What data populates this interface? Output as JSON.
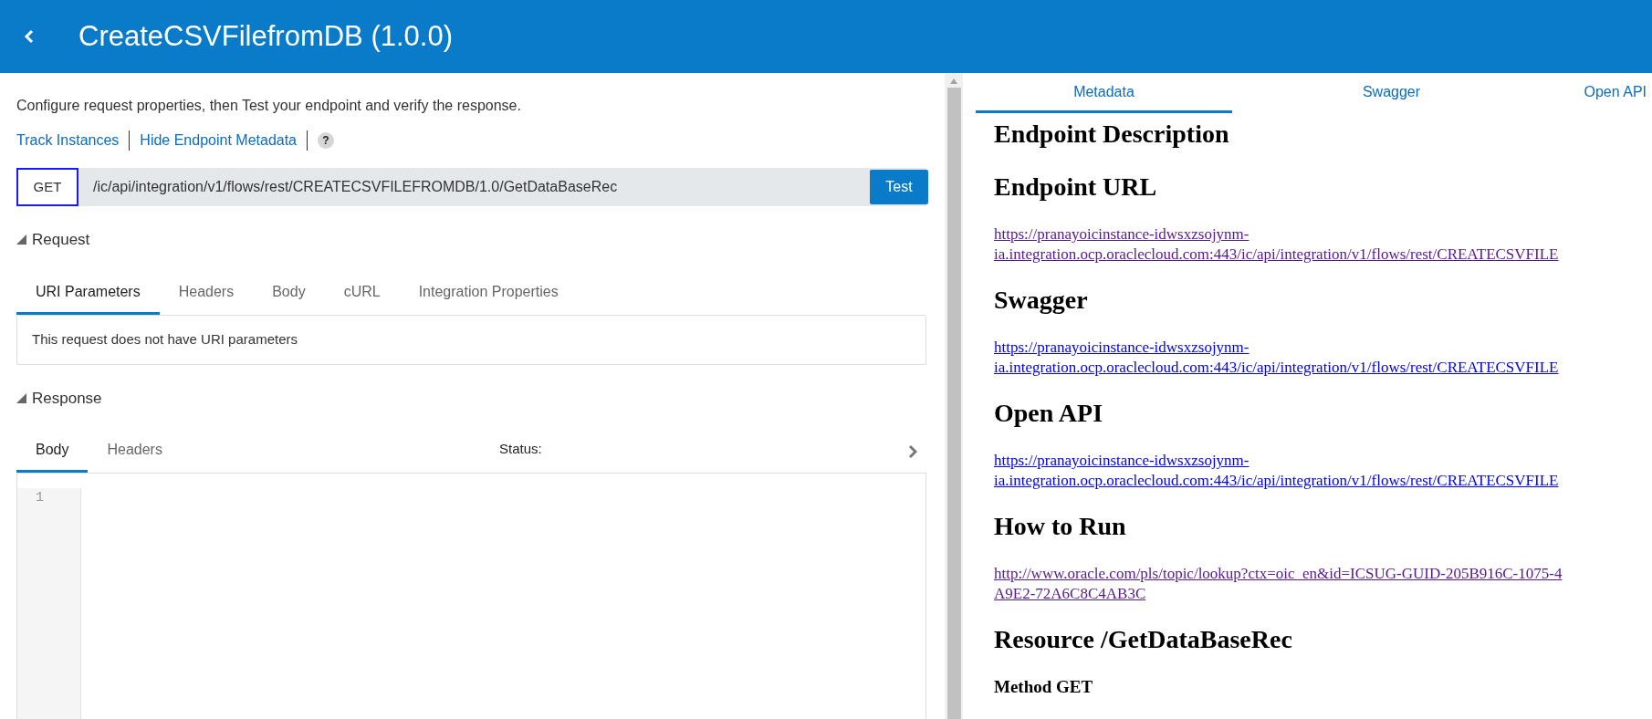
{
  "header": {
    "title": "CreateCSVFilefromDB (1.0.0)"
  },
  "intro": "Configure request properties, then Test your endpoint and verify the response.",
  "links": [
    "Track Instances",
    "Hide Endpoint Metadata"
  ],
  "help": "?",
  "request_line": {
    "method": "GET",
    "url": "/ic/api/integration/v1/flows/rest/CREATECSVFILEFROMDB/1.0/GetDataBaseRec",
    "button": "Test"
  },
  "request": {
    "title": "Request",
    "expanded": true,
    "tabs": [
      {
        "label": "URI Parameters",
        "selected": true
      },
      {
        "label": "Headers",
        "selected": false
      },
      {
        "label": "Body",
        "selected": false
      },
      {
        "label": "cURL",
        "selected": false
      },
      {
        "label": "Integration Properties",
        "selected": false
      }
    ],
    "message": "This request does not have URI parameters"
  },
  "response": {
    "title": "Response",
    "expanded": true,
    "tabs": [
      {
        "label": "Body",
        "selected": true
      },
      {
        "label": "Headers",
        "selected": false
      }
    ],
    "status_label": "Status:",
    "line_numbers": [
      "1"
    ]
  },
  "metadata": {
    "tabs": [
      {
        "label": "Metadata",
        "selected": true
      },
      {
        "label": "Swagger",
        "selected": false
      },
      {
        "label": "Open API",
        "selected": false
      }
    ],
    "sections": [
      {
        "kind": "heading",
        "text": "Endpoint Description"
      },
      {
        "kind": "heading",
        "text": "Endpoint URL"
      },
      {
        "kind": "link",
        "lines": [
          "https://pranayoicinstance-idwsxzsojynm-",
          "ia.integration.ocp.oraclecloud.com:443/ic/api/integration/v1/flows/rest/CREATECSVFILE"
        ],
        "visited": true
      },
      {
        "kind": "heading",
        "text": "Swagger"
      },
      {
        "kind": "link",
        "lines": [
          "https://pranayoicinstance-idwsxzsojynm-",
          "ia.integration.ocp.oraclecloud.com:443/ic/api/integration/v1/flows/rest/CREATECSVFILE"
        ],
        "visited": false
      },
      {
        "kind": "heading",
        "text": "Open API"
      },
      {
        "kind": "link",
        "lines": [
          "https://pranayoicinstance-idwsxzsojynm-",
          "ia.integration.ocp.oraclecloud.com:443/ic/api/integration/v1/flows/rest/CREATECSVFILE"
        ],
        "visited": false
      },
      {
        "kind": "heading",
        "text": "How to Run"
      },
      {
        "kind": "link",
        "lines": [
          "http://www.oracle.com/pls/topic/lookup?ctx=oic_en&id=ICSUG-GUID-205B916C-1075-4",
          "A9E2-72A6C8C4AB3C"
        ],
        "visited": true
      },
      {
        "kind": "heading",
        "text": "Resource /GetDataBaseRec"
      },
      {
        "kind": "subheading",
        "text": "Method GET"
      }
    ]
  }
}
